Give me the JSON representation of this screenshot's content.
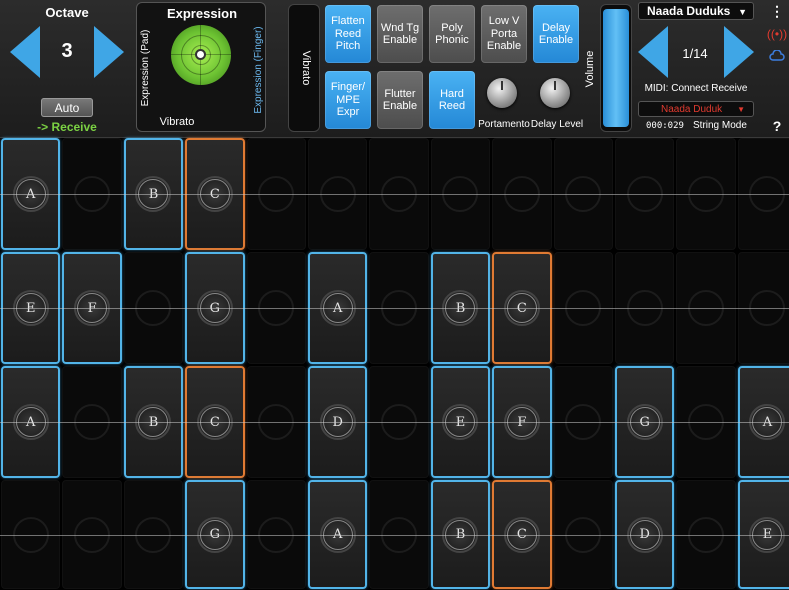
{
  "octave": {
    "label": "Octave",
    "value": "3",
    "auto_label": "Auto",
    "receive_label": "-> Receive"
  },
  "expression": {
    "title": "Expression",
    "left_axis": "Expression (Pad)",
    "right_axis": "Expression (Finger)",
    "bottom": "Vibrato"
  },
  "vibrato_label": "Vibrato",
  "buttons": [
    {
      "label": "Flatten Reed Pitch",
      "state": "on"
    },
    {
      "label": "Wnd Tg Enable",
      "state": "off"
    },
    {
      "label": "Poly Phonic",
      "state": "off"
    },
    {
      "label": "Low V Porta Enable",
      "state": "off"
    },
    {
      "label": "Delay Enable",
      "state": "on"
    },
    {
      "label": "Finger/ MPE Expr",
      "state": "on"
    },
    {
      "label": "Flutter Enable",
      "state": "off"
    },
    {
      "label": "Hard Reed",
      "state": "on"
    }
  ],
  "knobs": {
    "portamento": "Portamento",
    "delay": "Delay Level"
  },
  "volume_label": "Volume",
  "preset": {
    "title": "Naada Duduks",
    "counter": "1/14",
    "midi": "MIDI: Connect Receive",
    "instrument": "Naada Duduk",
    "time": "000:029",
    "mode": "String Mode"
  },
  "side_icons": {
    "menu": "more-icon",
    "signal": "broadcast-icon",
    "cloud": "cloud-icon",
    "help": "?"
  },
  "rows": [
    [
      "A",
      "",
      "B",
      "C",
      "",
      "",
      "",
      "",
      "",
      "",
      "",
      "",
      ""
    ],
    [
      "E",
      "F",
      "",
      "G",
      "",
      "A",
      "",
      "B",
      "C",
      "",
      "",
      "",
      ""
    ],
    [
      "A",
      "",
      "B",
      "C",
      "",
      "D",
      "",
      "E",
      "F",
      "",
      "G",
      "",
      "A"
    ],
    [
      "",
      "",
      "",
      "G",
      "",
      "A",
      "",
      "B",
      "C",
      "",
      "D",
      "",
      "E"
    ]
  ],
  "accent_colors": {
    "blue": "#52b4e8",
    "orange": "#e07a33",
    "green": "#7bd143",
    "red": "#e03a2f"
  }
}
